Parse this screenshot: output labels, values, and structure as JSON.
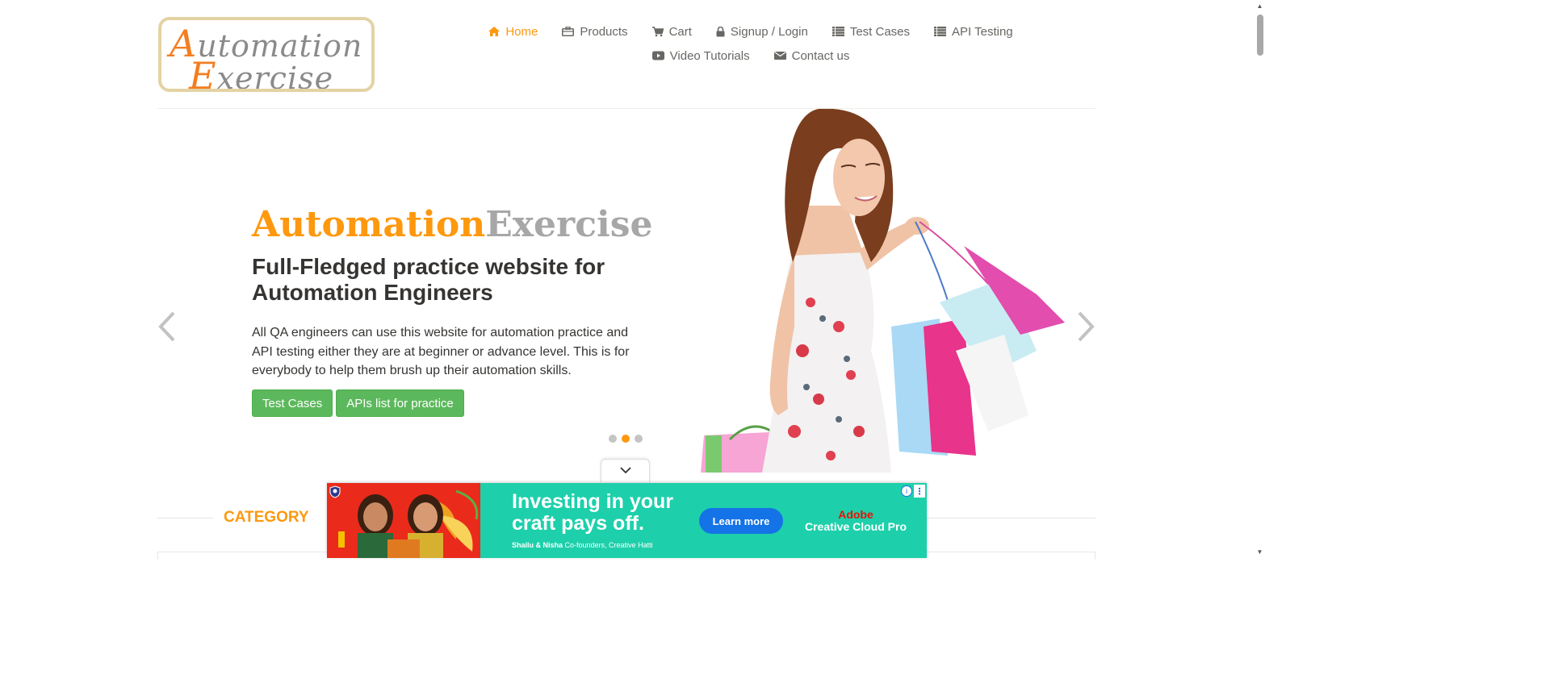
{
  "logo": {
    "line1_first": "A",
    "line1_rest": "utomation",
    "line2_first": "E",
    "line2_rest": "xercise"
  },
  "nav": {
    "row1": [
      {
        "label": "Home",
        "icon": "home-icon",
        "active": true
      },
      {
        "label": "Products",
        "icon": "briefcase-icon"
      },
      {
        "label": "Cart",
        "icon": "cart-icon"
      },
      {
        "label": "Signup / Login",
        "icon": "lock-icon"
      },
      {
        "label": "Test Cases",
        "icon": "list-icon"
      },
      {
        "label": "API Testing",
        "icon": "list-icon"
      }
    ],
    "row2": [
      {
        "label": "Video Tutorials",
        "icon": "youtube-icon"
      },
      {
        "label": "Contact us",
        "icon": "envelope-icon"
      }
    ]
  },
  "slider": {
    "brand_part1": "Automation",
    "brand_part2": "Exercise",
    "headline": "Full-Fledged practice website for Automation Engineers",
    "description": "All QA engineers can use this website for automation practice and API testing either they are at beginner or advance level. This is for everybody to help them brush up their automation skills.",
    "buttons": [
      "Test Cases",
      "APIs list for practice"
    ],
    "active_slide": 2,
    "slide_count": 3
  },
  "sidebar": {
    "category_title": "CATEGORY"
  },
  "ad": {
    "headline": "Investing in your craft pays off.",
    "sub_names": "Shailu & Nisha",
    "sub_role": "Co-founders, Creative Hatti",
    "cta": "Learn more",
    "brand": "Adobe",
    "product": "Creative Cloud Pro",
    "info": "i",
    "more": "⋮"
  },
  "colors": {
    "accent": "#fe980f",
    "button": "#5cb85c",
    "ad_bg": "#1dd0ab",
    "ad_cta": "#1473e6"
  }
}
